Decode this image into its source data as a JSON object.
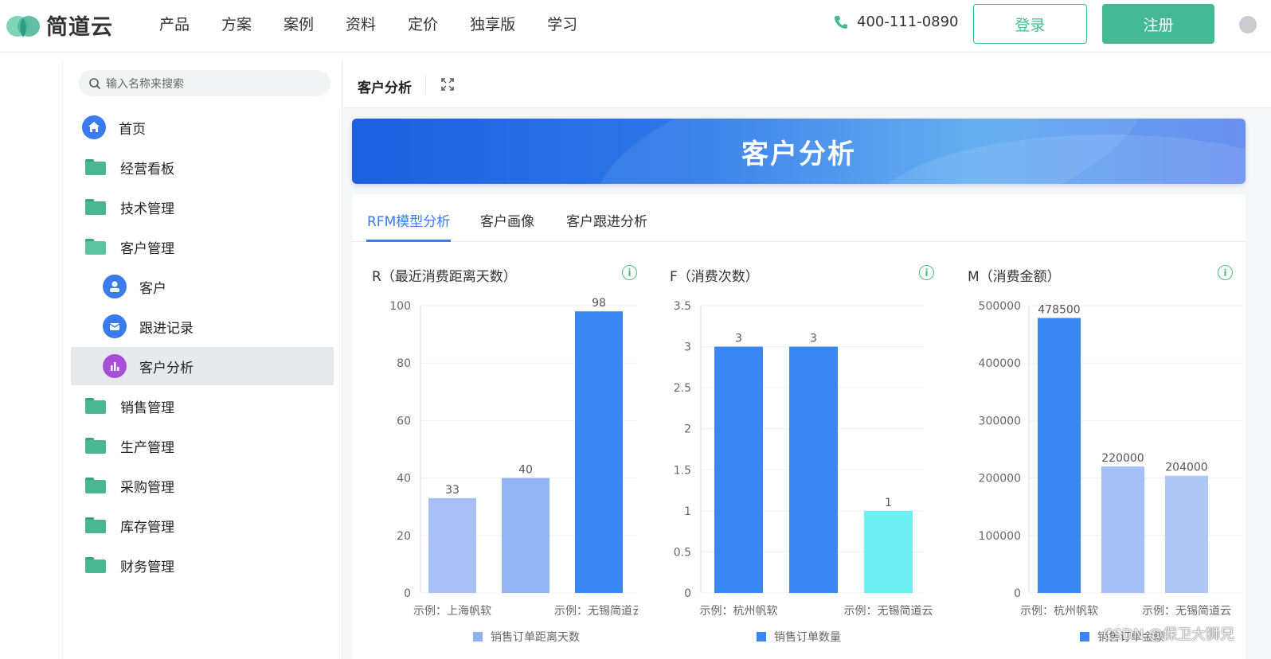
{
  "header": {
    "logo_text": "简道云",
    "nav": [
      "产品",
      "方案",
      "案例",
      "资料",
      "定价",
      "独享版",
      "学习"
    ],
    "phone": "400-111-0890",
    "login_label": "登录",
    "register_label": "注册",
    "accent_color": "#45b995"
  },
  "sidebar": {
    "search_placeholder": "输入名称来搜索",
    "items": [
      {
        "label": "首页",
        "icon": "home-icon",
        "level": 0
      },
      {
        "label": "经营看板",
        "icon": "folder-icon",
        "level": 0
      },
      {
        "label": "技术管理",
        "icon": "folder-icon",
        "level": 0
      },
      {
        "label": "客户管理",
        "icon": "folder-open-icon",
        "level": 0
      },
      {
        "label": "客户",
        "icon": "user-icon",
        "level": 1
      },
      {
        "label": "跟进记录",
        "icon": "message-icon",
        "level": 1
      },
      {
        "label": "客户分析",
        "icon": "bar-chart-icon",
        "level": 1,
        "active": true
      },
      {
        "label": "销售管理",
        "icon": "folder-icon",
        "level": 0
      },
      {
        "label": "生产管理",
        "icon": "folder-icon",
        "level": 0
      },
      {
        "label": "采购管理",
        "icon": "folder-icon",
        "level": 0
      },
      {
        "label": "库存管理",
        "icon": "folder-icon",
        "level": 0
      },
      {
        "label": "财务管理",
        "icon": "folder-icon",
        "level": 0
      }
    ]
  },
  "main": {
    "page_title": "客户分析",
    "banner_title": "客户分析",
    "tabs": [
      "RFM模型分析",
      "客户画像",
      "客户跟进分析"
    ],
    "active_tab": 0
  },
  "watermark": "CSDN @保卫大狮兄",
  "chart_data": [
    {
      "type": "bar",
      "title": "R（最近消费距离天数）",
      "x_tick_labels": [
        "示例：上海帆软",
        "示例：无锡简道云"
      ],
      "categories": [
        "示例：上海帆软",
        "",
        "示例：无锡简道云"
      ],
      "values": [
        33,
        40,
        98
      ],
      "colors": [
        "#a8c0f5",
        "#94b4f6",
        "#3a86f4"
      ],
      "ylim": [
        0,
        100
      ],
      "yticks": [
        0,
        20,
        40,
        60,
        80,
        100
      ],
      "legend": "销售订单距离天数",
      "legend_color": "#8fb0f0"
    },
    {
      "type": "bar",
      "title": "F（消费次数）",
      "x_tick_labels": [
        "示例：杭州帆软",
        "示例：无锡简道云"
      ],
      "categories": [
        "示例：杭州帆软",
        "",
        "示例：无锡简道云"
      ],
      "values": [
        3,
        3,
        1
      ],
      "colors": [
        "#3a86f4",
        "#3a86f4",
        "#6ef0f2"
      ],
      "ylim": [
        0,
        3.5
      ],
      "yticks": [
        0,
        0.5,
        1,
        1.5,
        2,
        2.5,
        3,
        3.5
      ],
      "legend": "销售订单数量",
      "legend_color": "#3a86f4"
    },
    {
      "type": "bar",
      "title": "M（消费金额）",
      "x_tick_labels": [
        "示例：杭州帆软",
        "示例：无锡简道云"
      ],
      "categories": [
        "示例：杭州帆软",
        "",
        "示例：无锡简道云"
      ],
      "values": [
        478500,
        220000,
        204000
      ],
      "colors": [
        "#3a86f4",
        "#a4c0f6",
        "#afc8f6"
      ],
      "ylim": [
        0,
        500000
      ],
      "yticks": [
        0,
        100000,
        200000,
        300000,
        400000,
        500000
      ],
      "legend": "销售订单金额",
      "legend_color": "#3a86f4"
    }
  ]
}
